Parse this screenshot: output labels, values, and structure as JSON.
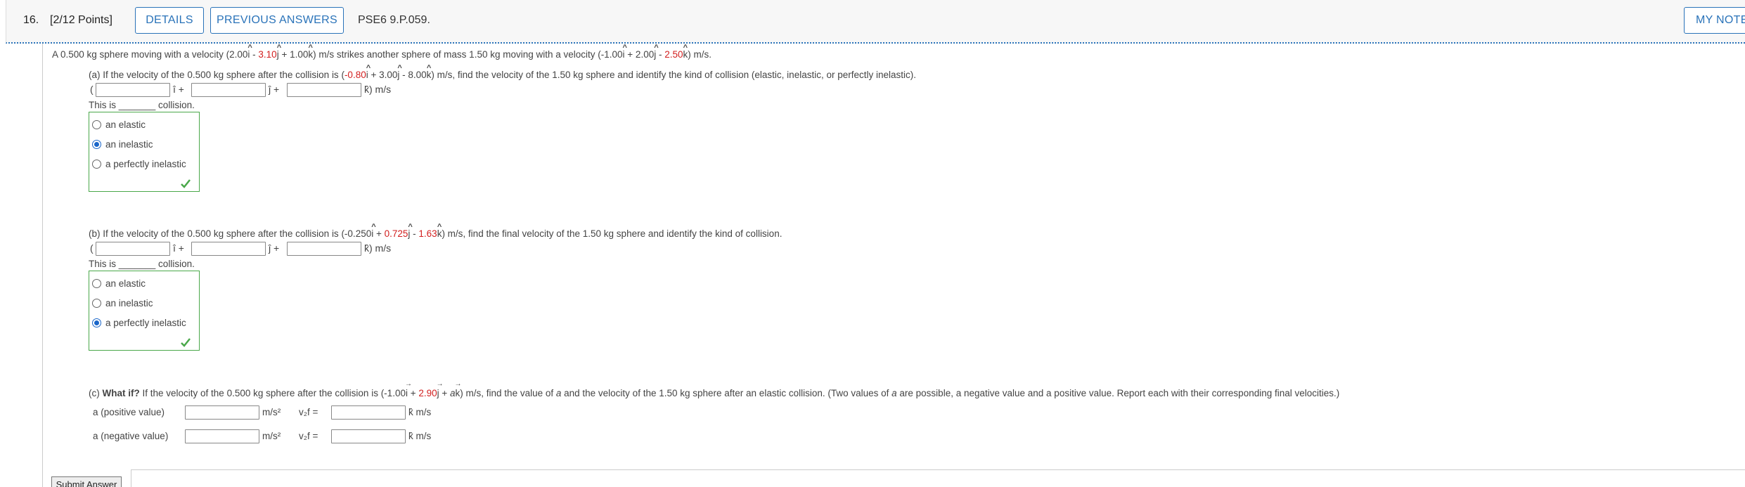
{
  "header": {
    "number": "16.",
    "points": "[2/12 Points]",
    "details_label": "DETAILS",
    "previous_answers_label": "PREVIOUS ANSWERS",
    "code": "PSE6 9.P.059.",
    "my_notes_label": "MY NOTES"
  },
  "problem": {
    "s1": "A 0.500 kg sphere moving with a velocity (2.00",
    "i": "i",
    "s2": " - ",
    "vy": "3.10",
    "j": "j",
    "s3": " + 1.00",
    "k": "k",
    "s4": ") m/s strikes another sphere of mass 1.50 kg moving with a velocity (-1.00",
    "s5": " + 2.00",
    "s6": " - ",
    "vz": "2.50",
    "s7": ") m/s."
  },
  "part_a": {
    "p1": "(a) If the velocity of the 0.500 kg sphere after the collision is (",
    "vx": "-0.80",
    "p2": " + 3.00",
    "p3": " - 8.00",
    "p4": ") m/s, find the velocity of the 1.50 kg sphere and identify the kind of collision (elastic, inelastic, or perfectly inelastic).",
    "open_paren": "(",
    "i_plus": "î +",
    "j_plus": "ĵ +",
    "k_unit": "k̂) m/s",
    "this_is": "This is _______ collision.",
    "options": [
      "an elastic",
      "an inelastic",
      "a perfectly inelastic"
    ],
    "selected": "an inelastic"
  },
  "part_b": {
    "p1": "(b) If the velocity of the 0.500 kg sphere after the collision is (-0.250",
    "p2": " + ",
    "vy": "0.725",
    "p3": " - ",
    "vz": "1.63",
    "p4": ") m/s, find the final velocity of the 1.50 kg sphere and identify the kind of collision.",
    "open_paren": "(",
    "i_plus": "î +",
    "j_plus": "ĵ +",
    "k_unit": "k̂) m/s",
    "this_is": "This is _______ collision.",
    "options": [
      "an elastic",
      "an inelastic",
      "a perfectly inelastic"
    ],
    "selected": "a perfectly inelastic"
  },
  "part_c": {
    "label": "(c) ",
    "what_if": "What if?",
    "p1": " If the velocity of the 0.500 kg sphere after the collision is (-1.00",
    "i": "i",
    "p2": " + ",
    "vy": "2.90",
    "j": "j",
    "p3": " + ",
    "a": "a",
    "k": "k",
    "p4": ") m/s, find the value of ",
    "p5": " and the velocity of the 1.50 kg sphere after an elastic collision. (Two values of ",
    "p6": " are possible, a negative value and a positive value. Report each with their corresponding final velocities.)",
    "pos_label": "a (positive value)",
    "neg_label": "a (negative value)",
    "unit_a": "m/s²",
    "v_label": "v₂f =",
    "k_unit": "k̂ m/s"
  },
  "submit_label": "Submit Answer"
}
